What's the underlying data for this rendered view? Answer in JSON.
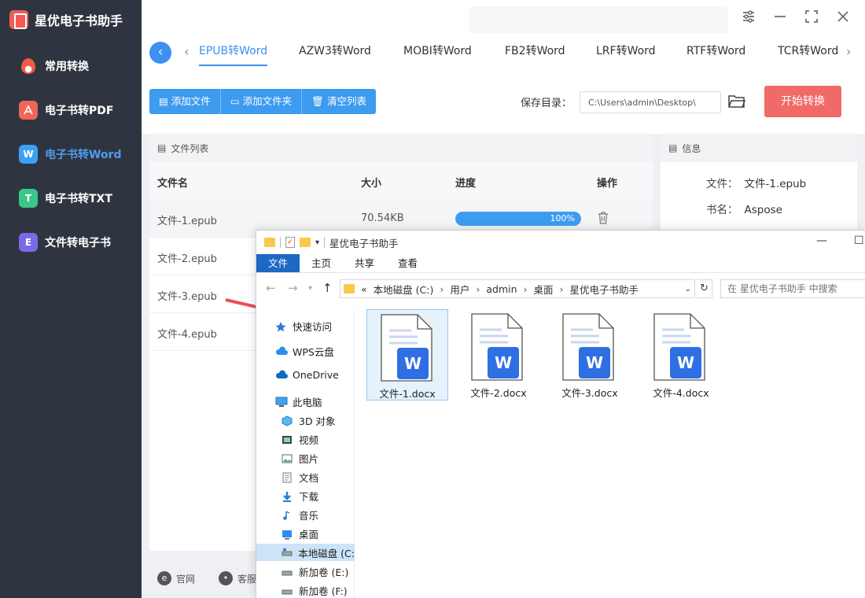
{
  "app": {
    "title": "星优电子书助手",
    "brand_color": "#f05b55",
    "accent_color": "#3d8ff0",
    "sidebar_bg": "#2f3540"
  },
  "sidebar": {
    "items": [
      {
        "label": "常用转换",
        "icon": "fire-icon",
        "active": false
      },
      {
        "label": "电子书转PDF",
        "icon": "pdf-icon",
        "active": false
      },
      {
        "label": "电子书转Word",
        "icon": "word-icon",
        "active": true
      },
      {
        "label": "电子书转TXT",
        "icon": "txt-icon",
        "active": false
      },
      {
        "label": "文件转电子书",
        "icon": "ebook-icon",
        "active": false
      }
    ],
    "icon_letters": [
      "",
      "",
      "W",
      "T",
      "E"
    ]
  },
  "tabs": [
    "EPUB转Word",
    "AZW3转Word",
    "MOBI转Word",
    "FB2转Word",
    "LRF转Word",
    "RTF转Word",
    "TCR转Word"
  ],
  "toolbar": {
    "add_file": "添加文件",
    "add_folder": "添加文件夹",
    "clear_list": "清空列表",
    "save_label": "保存目录：",
    "save_path": "C:\\Users\\admin\\Desktop\\",
    "start_label": "开始转换"
  },
  "file_panel": {
    "title": "文件列表",
    "columns": {
      "name": "文件名",
      "size": "大小",
      "progress": "进度",
      "action": "操作"
    },
    "rows": [
      {
        "name": "文件-1.epub",
        "size": "70.54KB",
        "progress": 1.0,
        "progress_text": "100%"
      },
      {
        "name": "文件-2.epub"
      },
      {
        "name": "文件-3.epub"
      },
      {
        "name": "文件-4.epub"
      }
    ]
  },
  "info_panel": {
    "title": "信息",
    "file_key": "文件：",
    "file_value": "文件-1.epub",
    "book_key": "书名：",
    "book_value": "Aspose"
  },
  "footer": {
    "website": "官网",
    "service": "客服"
  },
  "explorer": {
    "title": "星优电子书助手",
    "ribbon": [
      "文件",
      "主页",
      "共享",
      "查看"
    ],
    "path": [
      "«",
      "本地磁盘 (C:)",
      "用户",
      "admin",
      "桌面",
      "星优电子书助手"
    ],
    "search_placeholder": "在 星优电子书助手 中搜索",
    "tree": [
      {
        "label": "快速访问",
        "icon": "star-icon"
      },
      {
        "label": "WPS云盘",
        "icon": "cloud-icon"
      },
      {
        "label": "OneDrive",
        "icon": "onedrive-icon"
      },
      {
        "label": "此电脑",
        "icon": "pc-icon"
      },
      {
        "label": "3D 对象",
        "icon": "cube-icon"
      },
      {
        "label": "视频",
        "icon": "video-icon"
      },
      {
        "label": "图片",
        "icon": "picture-icon"
      },
      {
        "label": "文档",
        "icon": "document-icon"
      },
      {
        "label": "下载",
        "icon": "download-icon"
      },
      {
        "label": "音乐",
        "icon": "music-icon"
      },
      {
        "label": "桌面",
        "icon": "desktop-icon"
      },
      {
        "label": "本地磁盘 (C:",
        "icon": "drive-icon"
      },
      {
        "label": "新加卷 (E:)",
        "icon": "drive-icon"
      },
      {
        "label": "新加卷 (F:)",
        "icon": "drive-icon"
      }
    ],
    "files": [
      "文件-1.docx",
      "文件-2.docx",
      "文件-3.docx",
      "文件-4.docx"
    ],
    "word_letter": "W"
  }
}
